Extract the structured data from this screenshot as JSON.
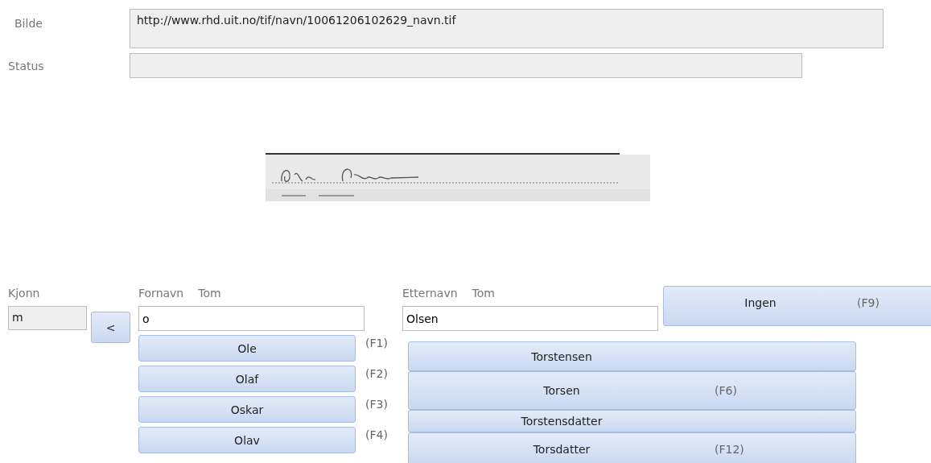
{
  "fields": [
    {
      "label": "Bilde",
      "value": "http://www.rhd.uit.no/tif/navn/10061206102629_navn.tif"
    },
    {
      "label": "Status"
    }
  ],
  "gender": {
    "label": "Kjonn",
    "value": "m"
  },
  "back_button": {
    "label": "<"
  },
  "first_name": {
    "label": "Fornavn",
    "note": "Tom",
    "value": "o",
    "suggestions": [
      {
        "name": "Ole",
        "shortcut": "(F1)"
      },
      {
        "name": "Olaf",
        "shortcut": "(F2)"
      },
      {
        "name": "Oskar",
        "shortcut": "(F3)"
      },
      {
        "name": "Olav",
        "shortcut": "(F4)"
      }
    ]
  },
  "last_name": {
    "label": "Etternavn",
    "note": "Tom",
    "value": "Olsen",
    "suggestions": [
      {
        "name": "Torstensen"
      },
      {
        "name": "Torsen",
        "shortcut": "(F6)"
      },
      {
        "name": "Torstensdatter"
      },
      {
        "name": "Torsdatter",
        "shortcut": "(F12)"
      }
    ]
  },
  "none_button": {
    "label": "Ingen",
    "shortcut": "(F9)"
  }
}
